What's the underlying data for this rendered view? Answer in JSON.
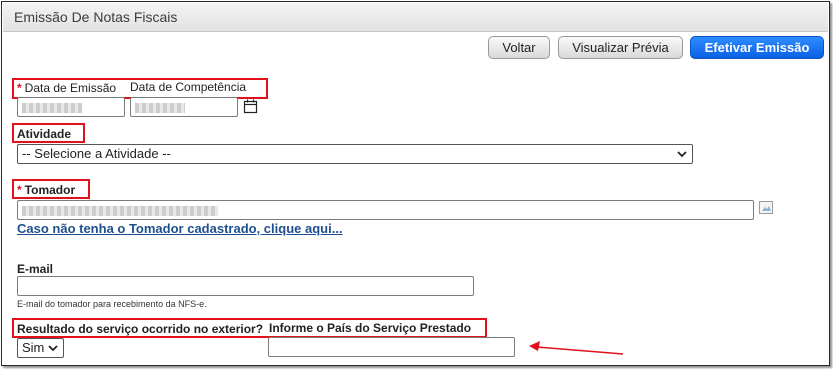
{
  "window": {
    "title": "Emissão De Notas Fiscais"
  },
  "toolbar": {
    "back_label": "Voltar",
    "preview_label": "Visualizar Prévia",
    "submit_label": "Efetivar Emissão"
  },
  "dates": {
    "required_mark": "*",
    "emission_label": "Data de Emissão",
    "competence_label": "Data de Competência"
  },
  "activity": {
    "label": "Atividade",
    "selected": "-- Selecione a Atividade --"
  },
  "taker": {
    "required_mark": "*",
    "label": "Tomador",
    "register_link": "Caso não tenha o Tomador cadastrado, clique aqui..."
  },
  "email": {
    "label": "E-mail",
    "help": "E-mail do tomador para recebimento da NFS-e."
  },
  "exterior": {
    "label": "Resultado do serviço ocorrido no exterior?",
    "country_label": "Informe o País do Serviço Prestado",
    "selected": "Sim"
  },
  "colors": {
    "highlight": "#e0111b",
    "primary": "#0a61e6",
    "link": "#1f4f8f"
  }
}
